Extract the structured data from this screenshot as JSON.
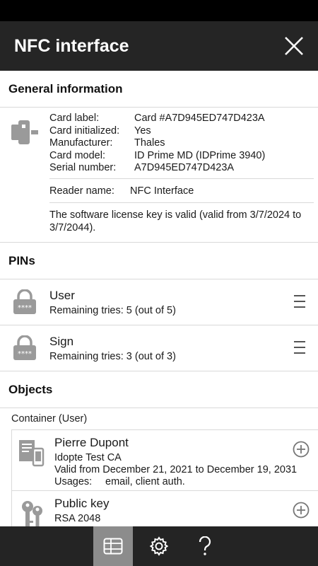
{
  "app_bar": {
    "title": "NFC interface",
    "close_icon": "close-icon"
  },
  "general": {
    "heading": "General information",
    "rows": [
      {
        "key": "Card label:",
        "value": "Card #A7D945ED747D423A"
      },
      {
        "key": "Card initialized:",
        "value": "Yes"
      },
      {
        "key": "Manufacturer:",
        "value": "Thales"
      },
      {
        "key": "Card model:",
        "value": "ID Prime MD (IDPrime 3940)"
      },
      {
        "key": "Serial number:",
        "value": "A7D945ED747D423A"
      }
    ],
    "reader_key": "Reader name:",
    "reader_value": "NFC Interface",
    "license": "The software license key is valid (valid from 3/7/2024 to 3/7/2044)."
  },
  "pins": {
    "heading": "PINs",
    "items": [
      {
        "name": "User",
        "tries": "Remaining tries: 5 (out of 5)"
      },
      {
        "name": "Sign",
        "tries": "Remaining tries: 3 (out of 3)"
      }
    ]
  },
  "objects": {
    "heading": "Objects",
    "container_label": "Container (User)",
    "items": [
      {
        "name": "Pierre Dupont",
        "line1": "Idopte Test CA",
        "line2": "Valid from December 21, 2021 to December 19, 2031",
        "line3_key": "Usages:",
        "line3_value": "email, client auth."
      },
      {
        "name": "Public key",
        "line1": "RSA 2048"
      }
    ]
  },
  "bottom_nav": {
    "items": [
      "card-icon",
      "gear-icon",
      "help-icon"
    ],
    "active_index": 0
  },
  "colors": {
    "app_bar": "#252525",
    "status_bar": "#000000",
    "active_tab": "#8c8c8c",
    "icon_gray": "#9a9a9a"
  }
}
